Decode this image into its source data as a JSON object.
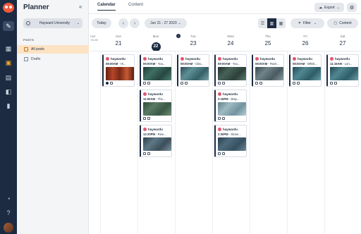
{
  "rail": {
    "icons": [
      "logo-icon",
      "compose-icon",
      "dashboard-icon",
      "calendar-icon",
      "inbox-icon",
      "briefcase-icon",
      "analytics-icon",
      "bell-icon",
      "help-icon"
    ]
  },
  "sidebar": {
    "title": "Planner",
    "collapse": "«",
    "org": "Hayward University",
    "section": "POSTS",
    "items": [
      {
        "label": "All posts",
        "active": true
      },
      {
        "label": "Drafts",
        "active": false
      }
    ]
  },
  "tabs": [
    {
      "label": "Calendar",
      "active": true
    },
    {
      "label": "Content",
      "active": false
    }
  ],
  "header": {
    "export": "Export",
    "export_icon": "cloud-icon",
    "gear": "⚙"
  },
  "toolbar": {
    "today": "Today",
    "prev": "‹",
    "next": "›",
    "range": "Jun 21 - 27 2023",
    "range_chevron": "⌄",
    "filter": "Filter",
    "content": "Content",
    "views": [
      "list-view-icon",
      "week-view-icon",
      "month-view-icon"
    ]
  },
  "calendar": {
    "timezone": [
      "GMT",
      "+01:00"
    ],
    "days": [
      {
        "name": "Sun",
        "date": "21",
        "today": false
      },
      {
        "name": "Mon",
        "date": "22",
        "today": true
      },
      {
        "name": "Tue",
        "date": "23",
        "today": false
      },
      {
        "name": "Wed",
        "date": "24",
        "today": false
      },
      {
        "name": "Thu",
        "date": "25",
        "today": false
      },
      {
        "name": "Fri",
        "date": "26",
        "today": false
      },
      {
        "name": "Sat",
        "date": "27",
        "today": false
      }
    ]
  },
  "posts": {
    "sun_1": {
      "user": "haywardu",
      "time": "08:00AM",
      "caption": " - Hi..."
    },
    "mon_1": {
      "user": "haywardu",
      "time": "09:00AM",
      "caption": " - You..."
    },
    "mon_2": {
      "user": "haywardu",
      "time": "11:00AM",
      "caption": " - The..."
    },
    "mon_3": {
      "user": "haywardu",
      "time": "12:30PM",
      "caption": " - Rive..."
    },
    "tue_1": {
      "user": "haywardu",
      "time": "09:00AM",
      "caption": " - Clov..."
    },
    "wed_1": {
      "user": "haywardu",
      "time": "09:00AM",
      "caption": " - You..."
    },
    "wed_2": {
      "user": "haywardu",
      "time": "2:15PM",
      "caption": " - Disp..."
    },
    "wed_3": {
      "user": "haywardu",
      "time": "2:30PM",
      "caption": " - Stone..."
    },
    "thu_1": {
      "user": "haywardu",
      "time": "08:00AM",
      "caption": " - Rock..."
    },
    "fri_1": {
      "user": "haywardu",
      "time": "08:00AM",
      "caption": " - Whist..."
    },
    "sat_1": {
      "user": "haywardu",
      "time": "11:15AM",
      "caption": " - Lon..."
    }
  }
}
